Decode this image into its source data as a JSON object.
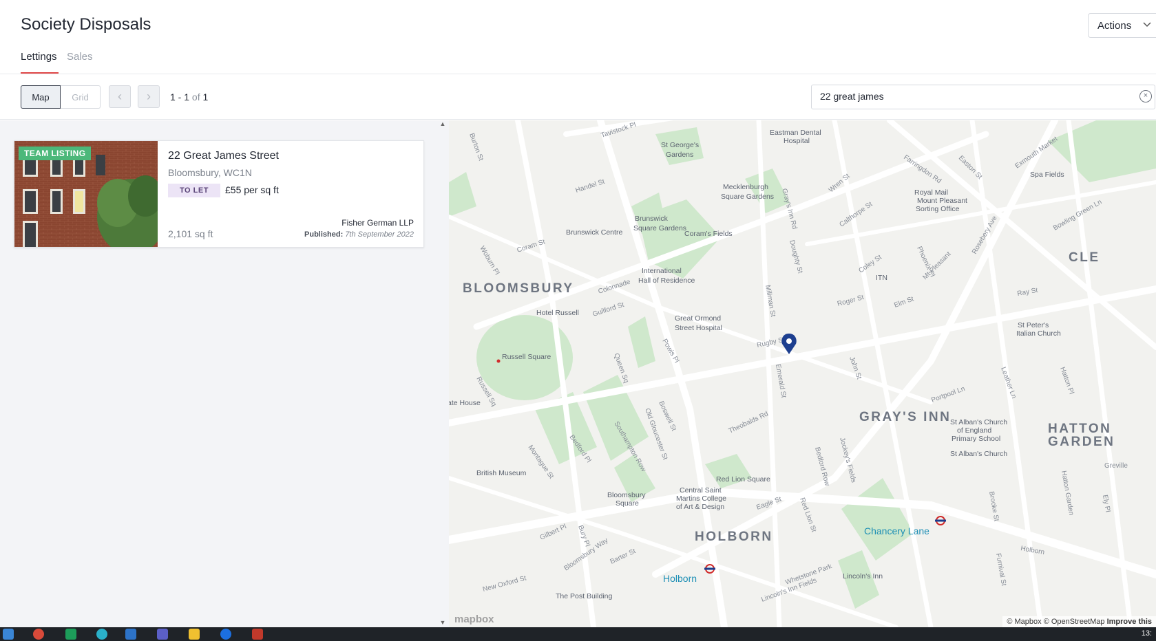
{
  "header": {
    "title": "Society Disposals",
    "actions_label": "Actions"
  },
  "tabs": [
    {
      "label": "Lettings",
      "active": true
    },
    {
      "label": "Sales",
      "active": false
    }
  ],
  "toolbar": {
    "view_map": "Map",
    "view_grid": "Grid",
    "range": "1 - 1",
    "of_label": "of",
    "total": "1",
    "search_value": "22 great james"
  },
  "listing": {
    "badge": "TEAM LISTING",
    "title": "22 Great James Street",
    "location": "Bloomsbury, WC1N",
    "status": "TO LET",
    "price": "£55 per sq ft",
    "size": "2,101 sq ft",
    "agent": "Fisher German LLP",
    "published_label": "Published:",
    "published_date": "7th September 2022"
  },
  "map": {
    "labels": [
      {
        "text": "BLOOMSBURY",
        "kind": "area"
      },
      {
        "text": "HOLBORN",
        "kind": "area"
      },
      {
        "text": "GRAY'S INN",
        "kind": "area"
      },
      {
        "text": "HATTON",
        "kind": "area"
      },
      {
        "text": "GARDEN",
        "kind": "area"
      },
      {
        "text": "CLE",
        "kind": "area"
      },
      {
        "text": "Russell Square",
        "kind": "poi"
      },
      {
        "text": "Hotel Russell",
        "kind": "poi"
      },
      {
        "text": "British Museum",
        "kind": "poi"
      },
      {
        "text": "Brunswick Centre",
        "kind": "poi"
      },
      {
        "text": "Coram's Fields",
        "kind": "poi"
      },
      {
        "text": "Great Ormond",
        "kind": "poi"
      },
      {
        "text": "Street Hospital",
        "kind": "poi"
      },
      {
        "text": "International",
        "kind": "poi"
      },
      {
        "text": "Hall of Residence",
        "kind": "poi"
      },
      {
        "text": "Mecklenburgh",
        "kind": "poi"
      },
      {
        "text": "Square Gardens",
        "kind": "poi"
      },
      {
        "text": "Brunswick",
        "kind": "poi"
      },
      {
        "text": "Square Gardens",
        "kind": "poi"
      },
      {
        "text": "St George's",
        "kind": "poi"
      },
      {
        "text": "Gardens",
        "kind": "poi"
      },
      {
        "text": "Eastman Dental",
        "kind": "poi"
      },
      {
        "text": "Hospital",
        "kind": "poi"
      },
      {
        "text": "Royal Mail",
        "kind": "poi"
      },
      {
        "text": "Mount Pleasant",
        "kind": "poi"
      },
      {
        "text": "Sorting Office",
        "kind": "poi"
      },
      {
        "text": "Spa Fields",
        "kind": "poi"
      },
      {
        "text": "ITN",
        "kind": "poi"
      },
      {
        "text": "St Peter's",
        "kind": "poi"
      },
      {
        "text": "Italian Church",
        "kind": "poi"
      },
      {
        "text": "St Alban's Church",
        "kind": "poi"
      },
      {
        "text": "of England",
        "kind": "poi"
      },
      {
        "text": "Primary School",
        "kind": "poi"
      },
      {
        "text": "St Alban's Church",
        "kind": "poi"
      },
      {
        "text": "Red Lion Square",
        "kind": "poi"
      },
      {
        "text": "Central Saint",
        "kind": "poi"
      },
      {
        "text": "Martins College",
        "kind": "poi"
      },
      {
        "text": "of Art & Design",
        "kind": "poi"
      },
      {
        "text": "Bloomsbury",
        "kind": "poi"
      },
      {
        "text": "Square",
        "kind": "poi"
      },
      {
        "text": "Lincoln's Inn",
        "kind": "poi"
      },
      {
        "text": "ate House",
        "kind": "poi"
      },
      {
        "text": "Chancery Lane",
        "kind": "station"
      },
      {
        "text": "Holborn",
        "kind": "station"
      },
      {
        "text": "Tavistock Pl",
        "kind": "street"
      },
      {
        "text": "Handel St",
        "kind": "street"
      },
      {
        "text": "Coram St",
        "kind": "street"
      },
      {
        "text": "Woburn Pl",
        "kind": "street"
      },
      {
        "text": "Guilford St",
        "kind": "street"
      },
      {
        "text": "Colonnade",
        "kind": "street"
      },
      {
        "text": "Russell Sq",
        "kind": "street"
      },
      {
        "text": "Queen Sq",
        "kind": "street"
      },
      {
        "text": "Bedford Pl",
        "kind": "street"
      },
      {
        "text": "Montague St",
        "kind": "street"
      },
      {
        "text": "Southampton Row",
        "kind": "street"
      },
      {
        "text": "Old Gloucester St",
        "kind": "street"
      },
      {
        "text": "Boswell St",
        "kind": "street"
      },
      {
        "text": "Theobalds Rd",
        "kind": "street"
      },
      {
        "text": "Rugby St",
        "kind": "street"
      },
      {
        "text": "Emerald St",
        "kind": "street"
      },
      {
        "text": "John St",
        "kind": "street"
      },
      {
        "text": "Millman St",
        "kind": "street"
      },
      {
        "text": "Doughty St",
        "kind": "street"
      },
      {
        "text": "Gray's Inn Rd",
        "kind": "street"
      },
      {
        "text": "Roger St",
        "kind": "street"
      },
      {
        "text": "Elm St",
        "kind": "street"
      },
      {
        "text": "Calthorpe St",
        "kind": "street"
      },
      {
        "text": "Wren St",
        "kind": "street"
      },
      {
        "text": "Farringdon Rd",
        "kind": "street"
      },
      {
        "text": "Bedford Row",
        "kind": "street"
      },
      {
        "text": "Jockey's Fields",
        "kind": "street"
      },
      {
        "text": "Red Lion St",
        "kind": "street"
      },
      {
        "text": "Eagle St",
        "kind": "street"
      },
      {
        "text": "Bloomsbury Way",
        "kind": "street"
      },
      {
        "text": "Barter St",
        "kind": "street"
      },
      {
        "text": "Gilbert Pl",
        "kind": "street"
      },
      {
        "text": "Bury Pl",
        "kind": "street"
      },
      {
        "text": "Portpool Ln",
        "kind": "street"
      },
      {
        "text": "Leather Ln",
        "kind": "street"
      },
      {
        "text": "Hatton Pl",
        "kind": "street"
      },
      {
        "text": "Hatton Garden",
        "kind": "street"
      },
      {
        "text": "Brooke St",
        "kind": "street"
      },
      {
        "text": "Greville",
        "kind": "street"
      },
      {
        "text": "Rosebery Ave",
        "kind": "street"
      },
      {
        "text": "Phoenix Pl",
        "kind": "street"
      },
      {
        "text": "Mt Pleasant",
        "kind": "street"
      },
      {
        "text": "Coley St",
        "kind": "street"
      },
      {
        "text": "Ray St",
        "kind": "street"
      },
      {
        "text": "Bowling Green Ln",
        "kind": "street"
      },
      {
        "text": "Exmouth Market",
        "kind": "street"
      },
      {
        "text": "Easton St",
        "kind": "street"
      },
      {
        "text": "Whetstone Park",
        "kind": "street"
      },
      {
        "text": "Lincoln's Inn Fields",
        "kind": "street"
      },
      {
        "text": "Burton St",
        "kind": "street"
      },
      {
        "text": "Powis Pl",
        "kind": "street"
      },
      {
        "text": "Furnival St",
        "kind": "street"
      },
      {
        "text": "Holborn",
        "kind": "street"
      },
      {
        "text": "The Post Building",
        "kind": "poi"
      },
      {
        "text": "New Oxford St",
        "kind": "street"
      },
      {
        "text": "Ely Pl",
        "kind": "street"
      }
    ],
    "attribution": "© Mapbox © OpenStreetMap",
    "improve": "Improve this",
    "logo": "mapbox"
  },
  "taskbar": {
    "clock": "13:"
  },
  "colors": {
    "accent": "#e04848",
    "badge": "#4cb87a",
    "status_bg": "#ece4f6",
    "marker": "#1d3f8f",
    "station": "#1e8fb5",
    "park": "#c8e6c4"
  }
}
